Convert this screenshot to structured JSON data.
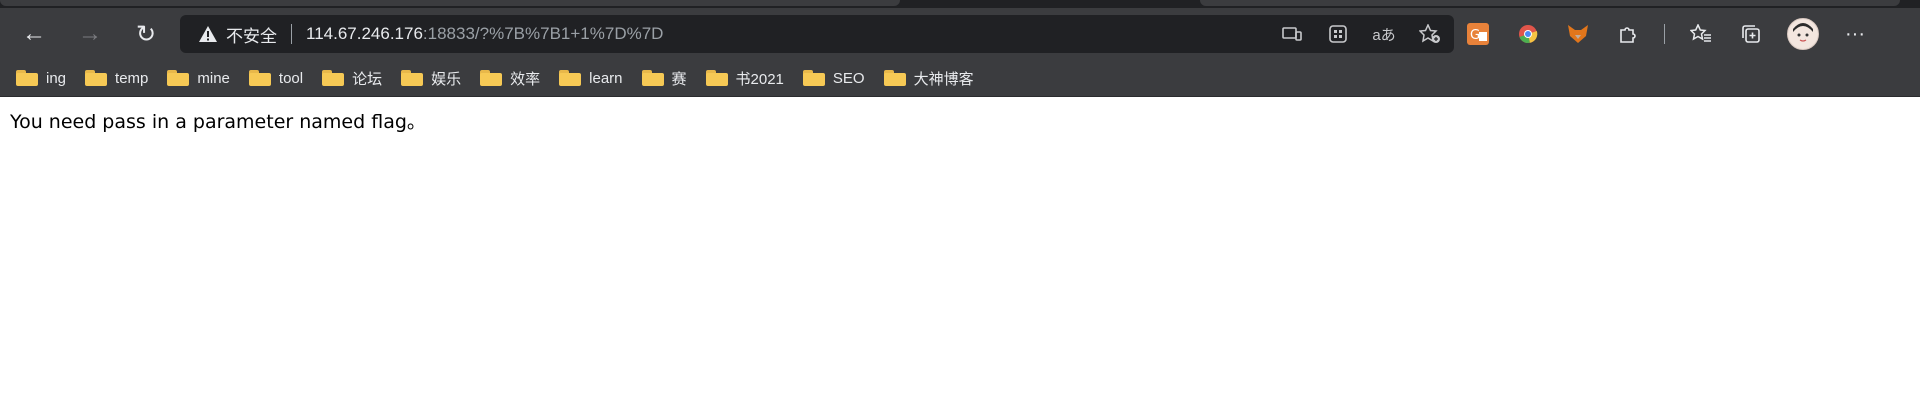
{
  "browser": {
    "nav": {
      "back": "←",
      "forward": "→",
      "reload": "↻"
    },
    "omnibox": {
      "security_label": "不安全",
      "url_host": "114.67.246.176",
      "url_rest": ":18833/?%7B%7B1+1%7D%7D"
    },
    "omnibox_icons": [
      "device-cast-icon",
      "apps-icon",
      "read-aloud-icon",
      "add-favorite-icon"
    ],
    "extensions": [
      "translate-extension-icon",
      "chrome-extension-icon",
      "fox-extension-icon",
      "puzzle-extensions-icon",
      "favorites-icon",
      "collections-icon",
      "profile-avatar",
      "more-icon"
    ],
    "more_label": "···",
    "bookmarks": [
      {
        "label": "ing"
      },
      {
        "label": "temp"
      },
      {
        "label": "mine"
      },
      {
        "label": "tool"
      },
      {
        "label": "论坛"
      },
      {
        "label": "娱乐"
      },
      {
        "label": "效率"
      },
      {
        "label": "learn"
      },
      {
        "label": "赛"
      },
      {
        "label": "书2021"
      },
      {
        "label": "SEO"
      },
      {
        "label": "大神博客"
      }
    ]
  },
  "page": {
    "message": "You need pass in a parameter named flag。"
  }
}
